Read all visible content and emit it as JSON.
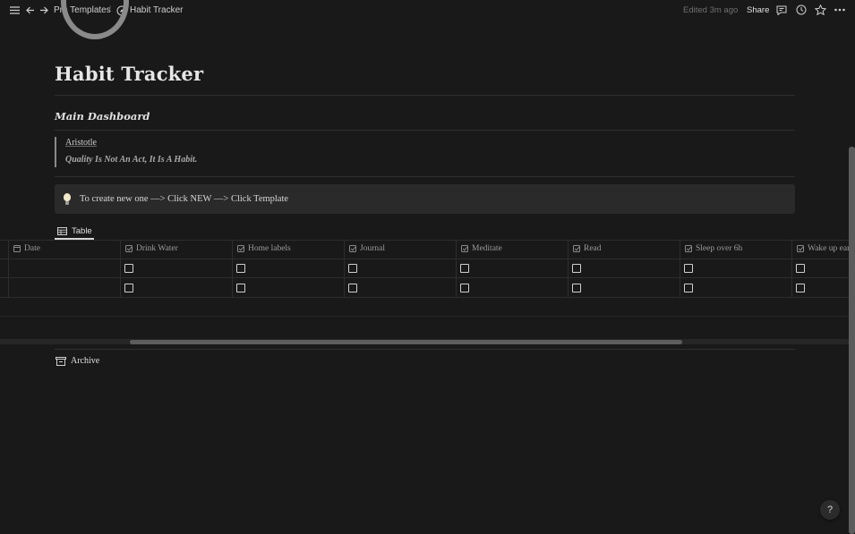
{
  "topbar": {
    "breadcrumb_parent": "Pro Templates",
    "breadcrumb_separator": "/",
    "breadcrumb_current": "Habit Tracker",
    "edited": "Edited 3m ago",
    "share": "Share"
  },
  "page": {
    "title": "Habit Tracker",
    "subheading": "Main Dashboard",
    "quote": {
      "author": "Aristotle",
      "text": "Quality Is Not An Act, It Is A Habit."
    },
    "callout": "To create new one —> Click NEW —> Click Template",
    "view_tab": "Table",
    "archive": "Archive"
  },
  "table": {
    "columns": [
      {
        "label": "Date",
        "icon": "calendar-icon"
      },
      {
        "label": "Drink Water",
        "icon": "checkbox-icon"
      },
      {
        "label": "Home labels",
        "icon": "checkbox-icon"
      },
      {
        "label": "Journal",
        "icon": "checkbox-icon"
      },
      {
        "label": "Meditate",
        "icon": "checkbox-icon"
      },
      {
        "label": "Read",
        "icon": "checkbox-icon"
      },
      {
        "label": "Sleep over 6h",
        "icon": "checkbox-icon"
      },
      {
        "label": "Wake up ear",
        "icon": "checkbox-icon"
      }
    ],
    "rows": [
      {
        "date": "",
        "checks": [
          false,
          false,
          false,
          false,
          false,
          false,
          false
        ]
      },
      {
        "date": "",
        "checks": [
          false,
          false,
          false,
          false,
          false,
          false,
          false
        ]
      }
    ]
  },
  "help": "?",
  "colors": {
    "background": "#191919",
    "callout": "#2a2a2a",
    "text": "#d4d4d4",
    "muted": "#9b9b9b"
  }
}
